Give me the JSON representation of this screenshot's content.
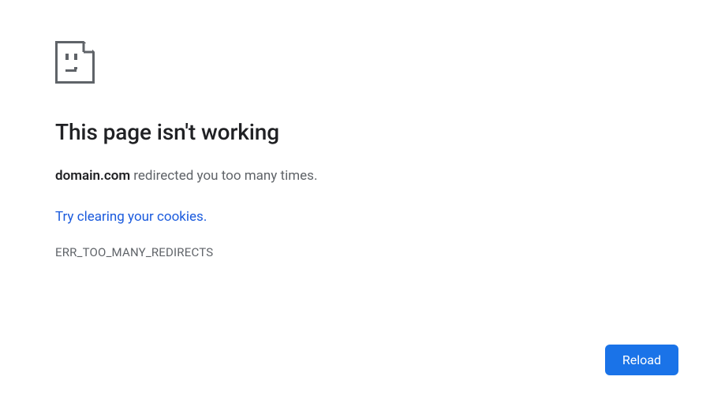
{
  "heading": "This page isn't working",
  "domain": "domain.com",
  "message_suffix": " redirected you too many times.",
  "suggestion_link": "Try clearing your cookies",
  "suggestion_period": ".",
  "error_code": "ERR_TOO_MANY_REDIRECTS",
  "reload_label": "Reload"
}
